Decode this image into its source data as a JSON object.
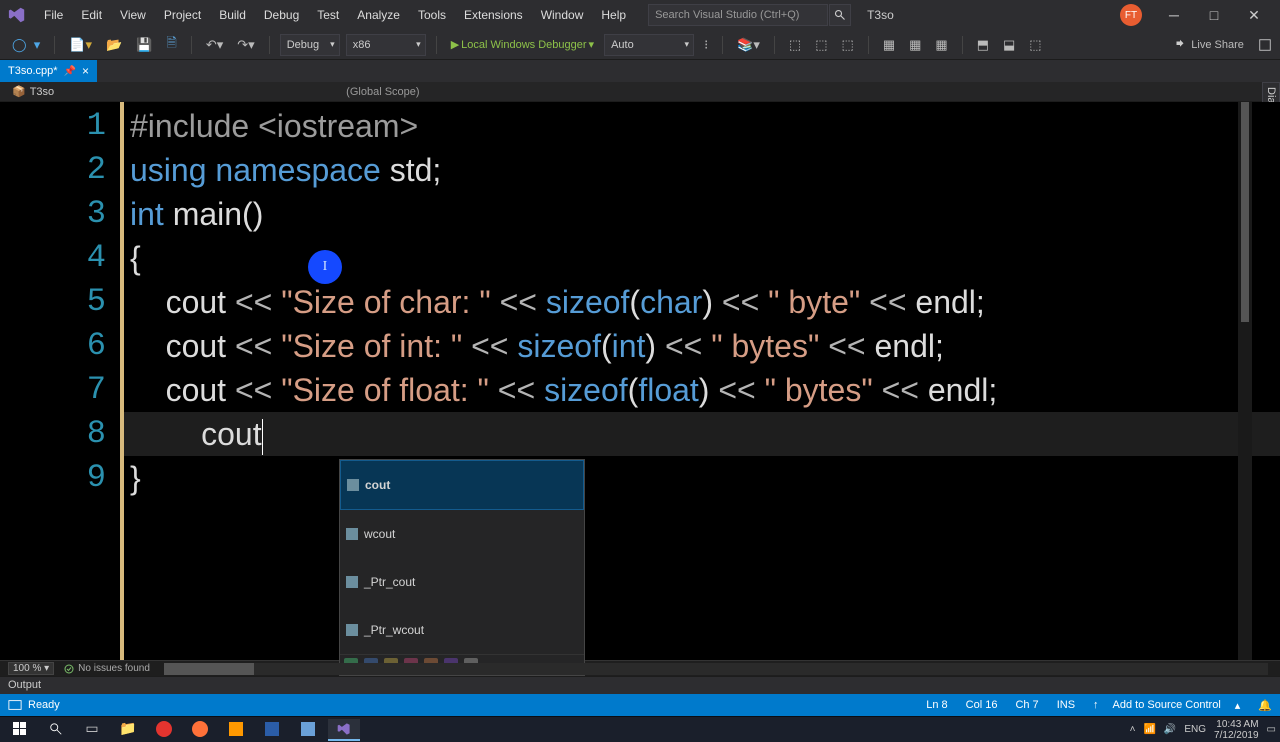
{
  "menubar": {
    "items": [
      "File",
      "Edit",
      "View",
      "Project",
      "Build",
      "Debug",
      "Test",
      "Analyze",
      "Tools",
      "Extensions",
      "Window",
      "Help"
    ],
    "search_placeholder": "Search Visual Studio (Ctrl+Q)",
    "project_name": "T3so",
    "user_initials": "FT"
  },
  "toolbar": {
    "config": "Debug",
    "platform": "x86",
    "debugger": "Local Windows Debugger",
    "threads": "Auto",
    "live_share": "Live Share"
  },
  "tab": {
    "label": "T3so.cpp*",
    "close": "×"
  },
  "breadcrumb": {
    "project": "T3so",
    "scope": "(Global Scope)"
  },
  "lines": [
    "1",
    "2",
    "3",
    "4",
    "5",
    "6",
    "7",
    "8",
    "9"
  ],
  "code": {
    "l1a": "#include ",
    "l1b": "<iostream>",
    "l2a": "using",
    "l2b": " namespace ",
    "l2c": "std",
    "l2d": ";",
    "l3a": "int",
    "l3b": " main()",
    "l4": "{",
    "l5a": "    cout ",
    "l5b": "<<",
    "l5c": " ",
    "l5d": "\"Size of char: \"",
    "l5e": " ",
    "l5f": "<<",
    "l5g": " ",
    "l5h": "sizeof",
    "l5i": "(",
    "l5j": "char",
    "l5k": ") ",
    "l5l": "<<",
    "l5m": " ",
    "l5n": "\" byte\"",
    "l5o": " ",
    "l5p": "<<",
    "l5q": " endl;",
    "l6a": "    cout ",
    "l6d": "\"Size of int: \"",
    "l6j": "int",
    "l6n": "\" bytes\"",
    "l7a": "    cout ",
    "l7d": "\"Size of float: \"",
    "l7j": "float",
    "l7n": "\" bytes\"",
    "l8": "        cout",
    "l9": "}"
  },
  "intellisense": {
    "items": [
      "cout",
      "wcout",
      "_Ptr_cout",
      "_Ptr_wcout"
    ]
  },
  "status_strip": {
    "zoom": "100 %",
    "issues": "No issues found"
  },
  "output_label": "Output",
  "statusbar": {
    "ready": "Ready",
    "ln": "Ln 8",
    "col": "Col 16",
    "ch": "Ch 7",
    "ins": "INS",
    "add_source": "Add to Source Control"
  },
  "tray": {
    "lang": "ENG",
    "time": "10:43 AM",
    "date": "7/12/2019"
  },
  "side_panel": "Diagnostic Tools"
}
